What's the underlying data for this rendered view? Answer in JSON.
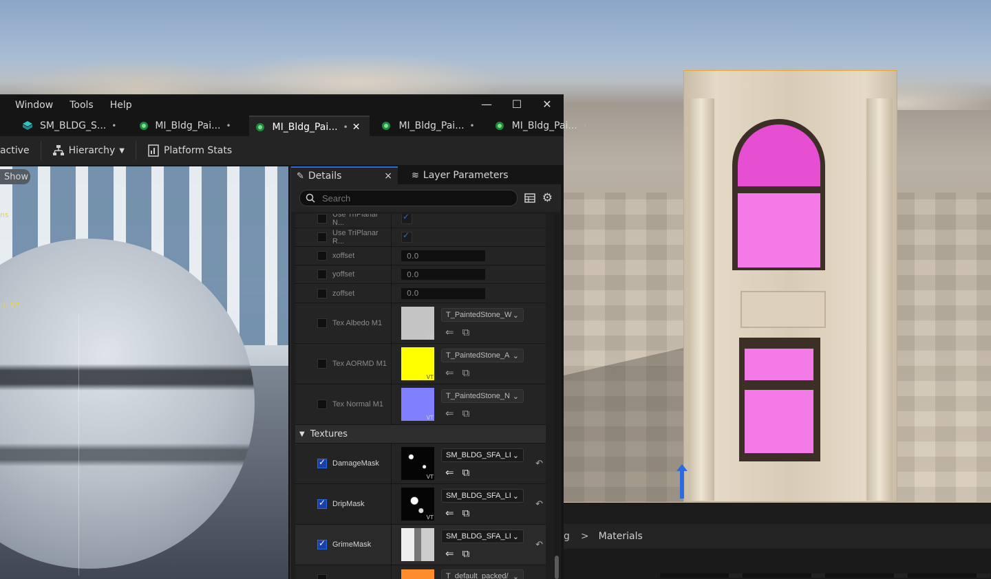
{
  "menu": [
    "Window",
    "Tools",
    "Help"
  ],
  "window_controls": {
    "minimize": "—",
    "maximize": "☐",
    "close": "✕"
  },
  "tabs": [
    {
      "label": "SM_BLDG_S...",
      "modified": "•",
      "active": false
    },
    {
      "label": "MI_Bldg_Pai...",
      "modified": "•",
      "active": false
    },
    {
      "label": "MI_Bldg_Pai...",
      "modified": "•",
      "active": true,
      "close": "✕"
    },
    {
      "label": "MI_Bldg_Pai...",
      "modified": "•",
      "active": false
    },
    {
      "label": "MI_Bldg_Pai...",
      "modified": "•",
      "active": false
    }
  ],
  "toolbar": {
    "live_label": "active",
    "hierarchy_label": "Hierarchy",
    "platform_stats_label": "Platform Stats"
  },
  "viewport": {
    "show_label": "Show",
    "stat_text_1": "ns",
    "stat_text_2": ".): 57"
  },
  "details": {
    "tab_label": "Details",
    "tab_close": "×",
    "layer_params_label": "Layer Parameters",
    "search_placeholder": "Search",
    "rows": [
      {
        "label": "Use TriPlanar N..."
      },
      {
        "label": "Use TriPlanar R..."
      },
      {
        "label": "xoffset",
        "value": "0.0"
      },
      {
        "label": "yoffset",
        "value": "0.0"
      },
      {
        "label": "zoffset",
        "value": "0.0"
      },
      {
        "label": "Tex Albedo M1",
        "asset": "T_PaintedStone_W"
      },
      {
        "label": "Tex AORMD M1",
        "asset": "T_PaintedStone_A"
      },
      {
        "label": "Tex Normal M1",
        "asset": "T_PaintedStone_N"
      }
    ],
    "textures_section": "Textures",
    "texture_rows": [
      {
        "label": "DamageMask",
        "asset": "SM_BLDG_SFA_LI"
      },
      {
        "label": "DripMask",
        "asset": "SM_BLDG_SFA_LI"
      },
      {
        "label": "GrimeMask",
        "asset": "SM_BLDG_SFA_LI"
      },
      {
        "label": "",
        "asset": "T_default_packed/"
      }
    ],
    "vt_label": "VT"
  },
  "content_browser": {
    "breadcrumb_prev": "g",
    "breadcrumb_sep": ">",
    "breadcrumb_current": "Materials"
  },
  "colors": {
    "accent": "#2b6be0",
    "selection_outline": "#e7a53a",
    "albedo_swatch": "#c4c4c4",
    "aormd_swatch": "#ffff00",
    "normal_swatch": "#8080ff",
    "packed_swatch": "#ff8c2a",
    "missing_material": "#f47ae8"
  }
}
